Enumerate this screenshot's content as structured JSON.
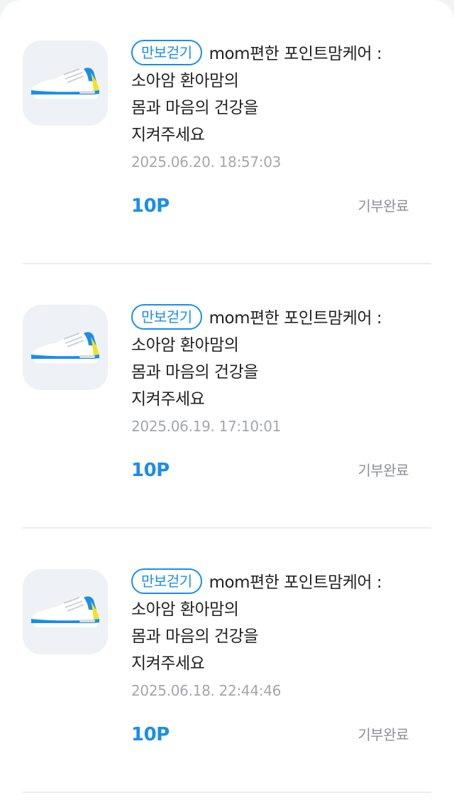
{
  "colors": {
    "accent": "#1a8ee8",
    "title_text": "#222222",
    "date_text": "#a3a6ab",
    "status_text": "#8c8f94",
    "thumbnail_bg": "#eef1f5"
  },
  "donations": [
    {
      "icon": "sneaker-icon",
      "tag": "만보걷기",
      "title_line1": "mom편한 포인트맘케어 :",
      "title_line2": "소아암 환아맘의",
      "title_line3": "몸과 마음의 건강을",
      "title_line4": "지켜주세요",
      "date": "2025.06.20. 18:57:03",
      "points": "10P",
      "status": "기부완료"
    },
    {
      "icon": "sneaker-icon",
      "tag": "만보걷기",
      "title_line1": "mom편한 포인트맘케어 :",
      "title_line2": "소아암 환아맘의",
      "title_line3": "몸과 마음의 건강을",
      "title_line4": "지켜주세요",
      "date": "2025.06.19. 17:10:01",
      "points": "10P",
      "status": "기부완료"
    },
    {
      "icon": "sneaker-icon",
      "tag": "만보걷기",
      "title_line1": "mom편한 포인트맘케어 :",
      "title_line2": "소아암 환아맘의",
      "title_line3": "몸과 마음의 건강을",
      "title_line4": "지켜주세요",
      "date": "2025.06.18. 22:44:46",
      "points": "10P",
      "status": "기부완료"
    }
  ]
}
